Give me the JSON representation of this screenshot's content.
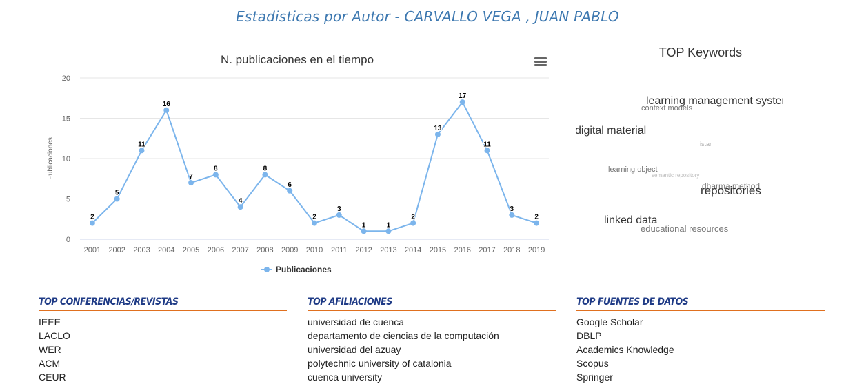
{
  "page": {
    "title": "Estadisticas por Autor - CARVALLO VEGA , JUAN PABLO"
  },
  "chart_data": {
    "type": "line",
    "title": "N. publicaciones en el tiempo",
    "ylabel": "Publicaciones",
    "xlabel": "",
    "categories": [
      "2001",
      "2002",
      "2003",
      "2004",
      "2005",
      "2006",
      "2007",
      "2008",
      "2009",
      "2010",
      "2011",
      "2012",
      "2013",
      "2014",
      "2015",
      "2016",
      "2017",
      "2018",
      "2019"
    ],
    "series": [
      {
        "name": "Publicaciones",
        "values": [
          2,
          5,
          11,
          16,
          7,
          8,
          4,
          8,
          6,
          2,
          3,
          1,
          1,
          2,
          13,
          17,
          11,
          3,
          2
        ],
        "color": "#7cb5ec"
      }
    ],
    "ylim": [
      0,
      20
    ],
    "yticks": [
      0,
      5,
      10,
      15,
      20
    ],
    "grid": true,
    "legend": "bottom-center",
    "data_labels": true
  },
  "keywords": {
    "title": "TOP Keywords",
    "items": [
      {
        "text": "learning management system",
        "color": "#333333"
      },
      {
        "text": "context models",
        "color": "#777777"
      },
      {
        "text": "digital material",
        "color": "#333333"
      },
      {
        "text": "istar",
        "color": "#aaaaaa"
      },
      {
        "text": "learning object",
        "color": "#777777"
      },
      {
        "text": "semantic repository",
        "color": "#bbbbbb"
      },
      {
        "text": "dharma method",
        "color": "#777777"
      },
      {
        "text": "repositories",
        "color": "#333333"
      },
      {
        "text": "linked data",
        "color": "#333333"
      },
      {
        "text": "educational resources",
        "color": "#777777"
      }
    ]
  },
  "conferences": {
    "title": "TOP CONFERENCIAS/REVISTAS",
    "items": [
      "IEEE",
      "LACLO",
      "WER",
      "ACM",
      "CEUR"
    ]
  },
  "affiliations": {
    "title": "TOP AFILIACIONES",
    "items": [
      "universidad de cuenca",
      "departamento de ciencias de la computación",
      "universidad del azuay",
      "polytechnic university of catalonia",
      "cuenca university"
    ]
  },
  "sources": {
    "title": "TOP FUENTES DE DATOS",
    "items": [
      "Google Scholar",
      "DBLP",
      "Academics Knowledge",
      "Scopus",
      "Springer"
    ]
  }
}
